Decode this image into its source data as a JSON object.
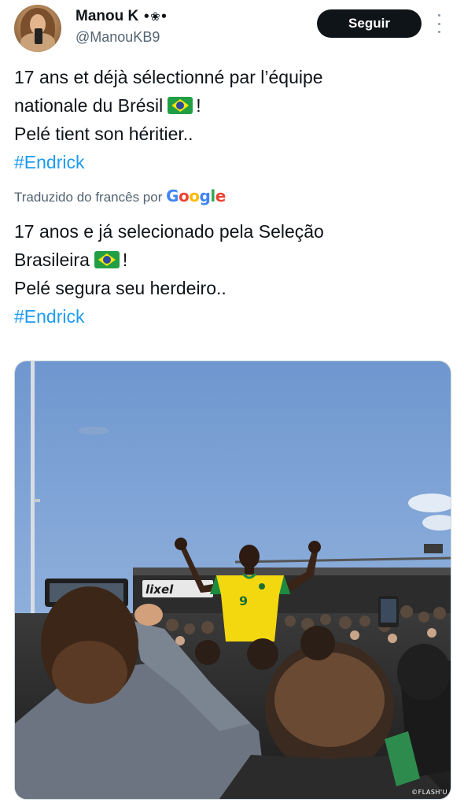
{
  "author": {
    "display_name": "Manou K",
    "name_emblem": "•❀•",
    "handle": "@ManouKB9"
  },
  "actions": {
    "follow_label": "Seguir",
    "more_icon": "more-vertical-icon"
  },
  "tweet": {
    "original": {
      "line1": "17 ans et déjà sélectionné par l’équipe",
      "line2_text": "nationale du Brésil",
      "line2_end": "!",
      "line3": "Pelé tient son héritier..",
      "hashtag": "#Endrick"
    },
    "translation_label": "Traduzido do francês por",
    "translation_provider": {
      "letters": [
        "G",
        "o",
        "o",
        "g",
        "l",
        "e"
      ]
    },
    "translated": {
      "line1": "17 anos e já selecionado pela Seleção",
      "line2_text": "Brasileira",
      "line2_end": "!",
      "line3": "Pelé segura seu herdeiro..",
      "hashtag": "#Endrick"
    },
    "flag_icon": "brazil-flag-icon"
  },
  "media": {
    "stadium_sign": "lixel",
    "jersey_number": "9",
    "photo_credit": "©FLASH'U"
  },
  "colors": {
    "link": "#1d9bf0",
    "follow_button_bg": "#0f1419",
    "secondary_text": "#536471",
    "sky": "#7a9fd3",
    "jersey_yellow": "#f4d80f"
  }
}
